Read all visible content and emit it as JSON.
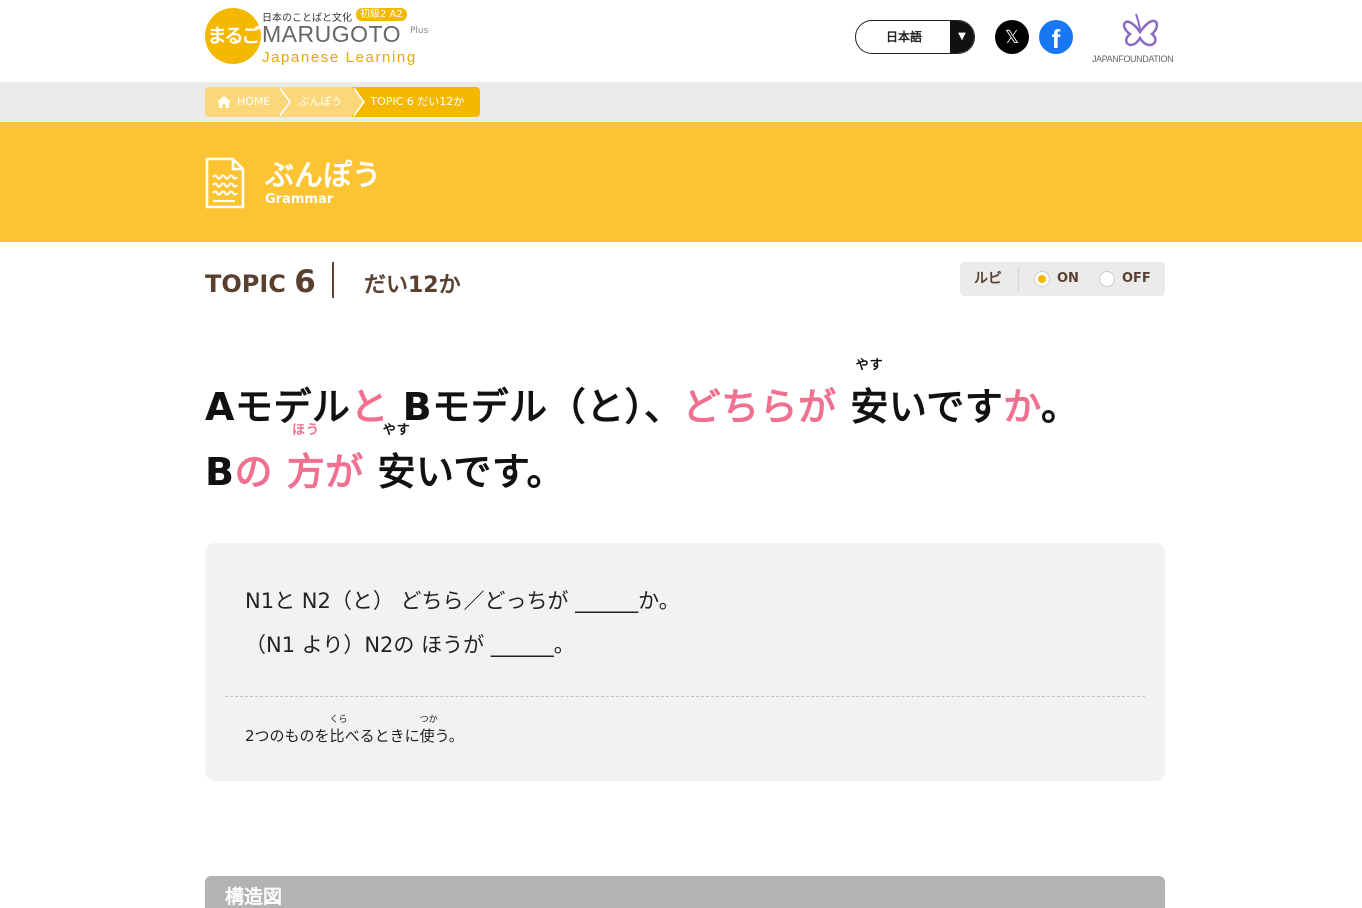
{
  "header": {
    "logo": {
      "mark": "まるごと",
      "subtitle": "日本のことばと文化",
      "level": "初級2 A2",
      "name": "MARUGOTO",
      "plus": "Plus",
      "tagline": "Japanese Learning"
    },
    "language": {
      "selected": "日本語",
      "arrow": "▼"
    },
    "sns": {
      "x": "𝕏",
      "facebook": "f"
    },
    "partner": "JAPANFOUNDATION"
  },
  "breadcrumb": {
    "home": "HOME",
    "section": "ぶんぽう",
    "current": "TOPIC 6 だい12か"
  },
  "band": {
    "title": "ぶんぽう",
    "subtitle": "Grammar"
  },
  "topic": {
    "label": "TOPIC",
    "number": "6",
    "lesson": "だい12か"
  },
  "ruby_toggle": {
    "label": "ルビ",
    "on": "ON",
    "off": "OFF",
    "selected": "ON"
  },
  "sentence": {
    "line1": {
      "a": "Aモデル",
      "to1": "と",
      "b": " Bモデル（と）、",
      "dochiraga": "どちらが",
      "yasu_kanji": "安",
      "yasu_ruby": "やす",
      "idesu": "いです",
      "ka": "か",
      "end": "。"
    },
    "line2": {
      "b": "B",
      "no": "の",
      "hou_kanji": "方",
      "hou_ruby": "ほう",
      "ga": "が",
      "yasu_kanji": "安",
      "yasu_ruby": "やす",
      "idesu": "いです。"
    }
  },
  "pattern": {
    "line1": "N1と N2（と） どちら／どっちが ______か。",
    "line2": "（N1 より）N2の ほうが ______。",
    "note": {
      "pre": "2つのものを",
      "k1": "比",
      "r1": "くら",
      "mid": "べるときに",
      "k2": "使",
      "r2": "つか",
      "post": "う。"
    }
  },
  "structure": {
    "title": "構造図"
  },
  "colors": {
    "accent": "#fcc433",
    "highlight": "#f0708f",
    "brown": "#5a4030"
  }
}
